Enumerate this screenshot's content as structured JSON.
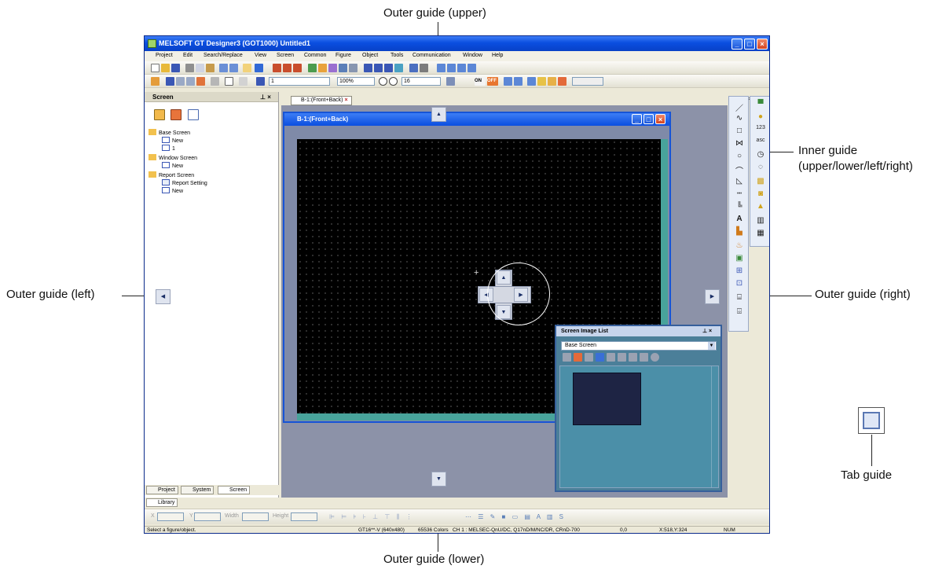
{
  "annotations": {
    "outer_upper": "Outer guide (upper)",
    "outer_lower": "Outer guide (lower)",
    "outer_left": "Outer guide (left)",
    "outer_right": "Outer guide (right)",
    "inner_line1": "Inner guide",
    "inner_line2": "(upper/lower/left/right)",
    "tab_guide": "Tab guide"
  },
  "app": {
    "title": "MELSOFT GT Designer3 (GOT1000) Untitled1",
    "menu": [
      "Project",
      "Edit",
      "Search/Replace",
      "View",
      "Screen",
      "Common",
      "Figure",
      "Object",
      "Tools",
      "Communication",
      "Window",
      "Help"
    ]
  },
  "toolbar": {
    "combo_screen": "1",
    "zoom": "100%",
    "font_size": "16",
    "on_label": "ON",
    "off_label": "OFF"
  },
  "screen_panel": {
    "title": "Screen",
    "pin": "↕ ×",
    "tree": [
      {
        "label": "Base Screen",
        "level": 0
      },
      {
        "label": "New",
        "level": 1
      },
      {
        "label": "1",
        "level": 1
      },
      {
        "label": "Window Screen",
        "level": 0
      },
      {
        "label": "New",
        "level": 1
      },
      {
        "label": "Report Screen",
        "level": 0
      },
      {
        "label": "Report Setting",
        "level": 1
      },
      {
        "label": "New",
        "level": 1
      }
    ],
    "bottom_tabs": [
      "Project",
      "System",
      "Screen"
    ]
  },
  "editor": {
    "tab_label": "B-1:(Front+Back)",
    "window_title": "B-1:(Front+Back)"
  },
  "library": {
    "tab_label": "Library"
  },
  "props_bar": {
    "x_label": "X",
    "y_label": "Y",
    "width_label": "Width",
    "height_label": "Height"
  },
  "screen_image_list": {
    "title": "Screen Image List",
    "selected": "Base Screen"
  },
  "status_bar": {
    "hint": "Select a figure/object.",
    "model": "GT16**-V (640x480)",
    "colors": "65536 Colors",
    "channel": "CH 1 : MELSEC-QnU/DC, Q17nD/M/NC/DR, CRnD-700",
    "origin": "0,0",
    "cursor": "X:518,Y:324",
    "num": "NUM"
  },
  "colors": {
    "titlebar": "#0a4ee0",
    "canvas": "#000000",
    "canvas_border": "#48a39b",
    "workspace": "#8c92a8"
  }
}
